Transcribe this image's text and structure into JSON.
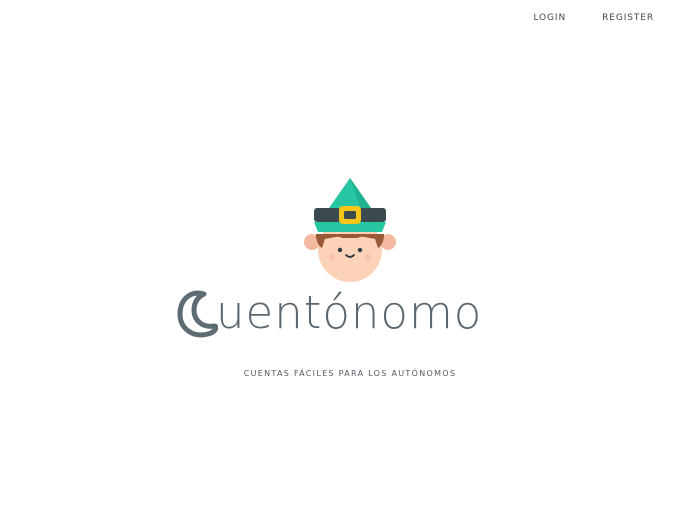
{
  "nav": {
    "login_label": "LOGIN",
    "register_label": "REGISTER"
  },
  "brand": {
    "wordmark": "uentónomo",
    "tagline": "CUENTAS FÁCILES PARA LOS AUTÓNOMOS"
  },
  "colors": {
    "hat": "#26c6a2",
    "hat_band": "#3a4a4e",
    "buckle": "#f5c518",
    "skin": "#fcd2b8",
    "hair": "#9a5a3a",
    "wordmark": "#5a6770",
    "moon": "#5d6b73"
  },
  "icons": {
    "mascot": "gnome-mascot-icon",
    "logo_letter": "crescent-moon-icon"
  }
}
